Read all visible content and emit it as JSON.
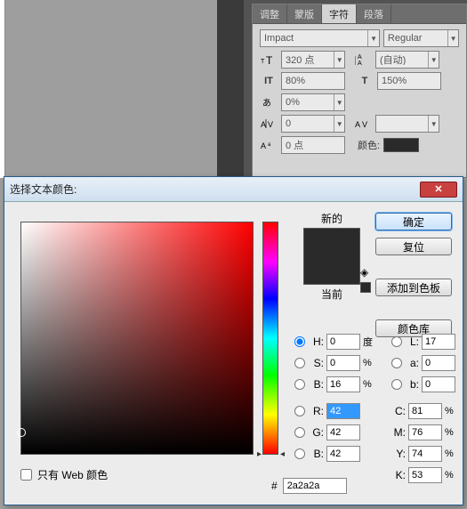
{
  "tabs": {
    "adjust": "调整",
    "mask": "蒙版",
    "char": "字符",
    "para": "段落"
  },
  "font": {
    "family": "Impact",
    "style": "Regular"
  },
  "size": {
    "value": "320 点",
    "leading": "(自动)"
  },
  "scale": {
    "v": "80%",
    "h": "150%"
  },
  "tsume": "0%",
  "tracking": "0",
  "kerning": "",
  "baseline": "0 点",
  "colorLabel": "颜色:",
  "dialog": {
    "title": "选择文本颜色:",
    "ok": "确定",
    "reset": "复位",
    "addSwatch": "添加到色板",
    "library": "颜色库",
    "new": "新的",
    "current": "当前",
    "webOnly": "只有 Web 颜色",
    "H": "0",
    "S": "0",
    "B": "16",
    "L": "17",
    "a": "0",
    "b2": "0",
    "R": "42",
    "G": "42",
    "B2": "42",
    "C": "81",
    "M": "76",
    "Y": "74",
    "K": "53",
    "deg": "度",
    "pct": "%",
    "hex": "2a2a2a",
    "hash": "#"
  },
  "labels": {
    "H": "H:",
    "S": "S:",
    "B": "B:",
    "L": "L:",
    "a": "a:",
    "b": "b:",
    "R": "R:",
    "G": "G:",
    "B2": "B:",
    "C": "C:",
    "M": "M:",
    "Y": "Y:",
    "K": "K:"
  }
}
